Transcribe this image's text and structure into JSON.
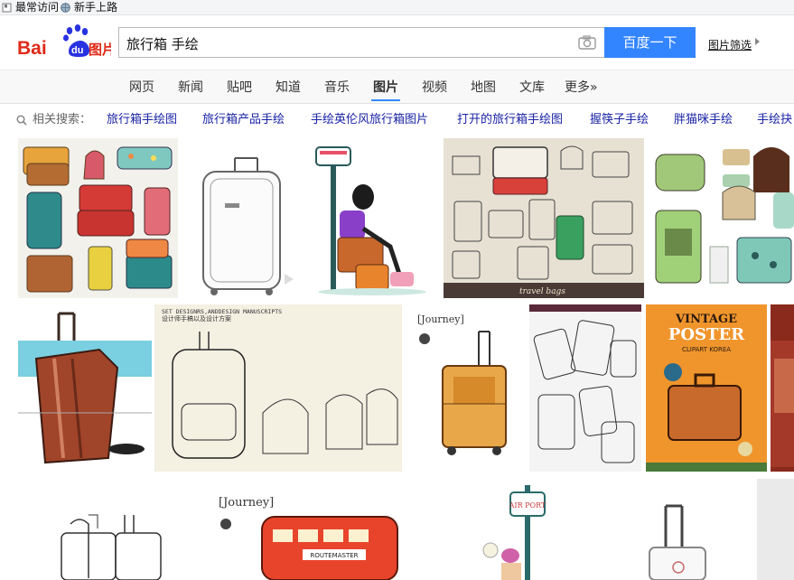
{
  "bookmarks": {
    "frequent_label": "最常访问",
    "newbie_label": "新手上路"
  },
  "logo": {
    "text_bai": "Bai",
    "text_du": "du",
    "text_pic": "图片",
    "brand_red": "#de2a18",
    "brand_blue": "#2932e1"
  },
  "search": {
    "query": "旅行箱 手绘",
    "button_label": "百度一下",
    "filter_label": "图片筛选",
    "camera_icon": "camera-icon",
    "button_color": "#3385ff"
  },
  "tabs": [
    {
      "label": "网页"
    },
    {
      "label": "新闻"
    },
    {
      "label": "贴吧"
    },
    {
      "label": "知道"
    },
    {
      "label": "音乐"
    },
    {
      "label": "图片",
      "active": true
    },
    {
      "label": "视频"
    },
    {
      "label": "地图"
    },
    {
      "label": "文库"
    },
    {
      "label": "更多»"
    }
  ],
  "related": {
    "label": "相关搜索：",
    "items": [
      "旅行箱手绘图",
      "旅行箱产品手绘",
      "手绘英伦风旅行箱图片",
      "打开的旅行箱手绘图",
      "握筷子手绘",
      "胖猫咪手绘",
      "手绘抉"
    ],
    "link_color": "#1a23a5"
  },
  "images": {
    "travel_bags_caption": "travel bags",
    "design_manuscript_line1": "SET DESIGNRS,ANDDESIGN MANUSCRIPTS",
    "design_manuscript_line2": "设计师手稿以及设计方案",
    "journey_label": "[Journey]",
    "poster_title": "VINTAGE",
    "poster_title2": "POSTER",
    "poster_sub": "CLIPART KOREA",
    "airport_sign": "AIR PORT",
    "bus_sign": "ROUTEMASTER"
  }
}
